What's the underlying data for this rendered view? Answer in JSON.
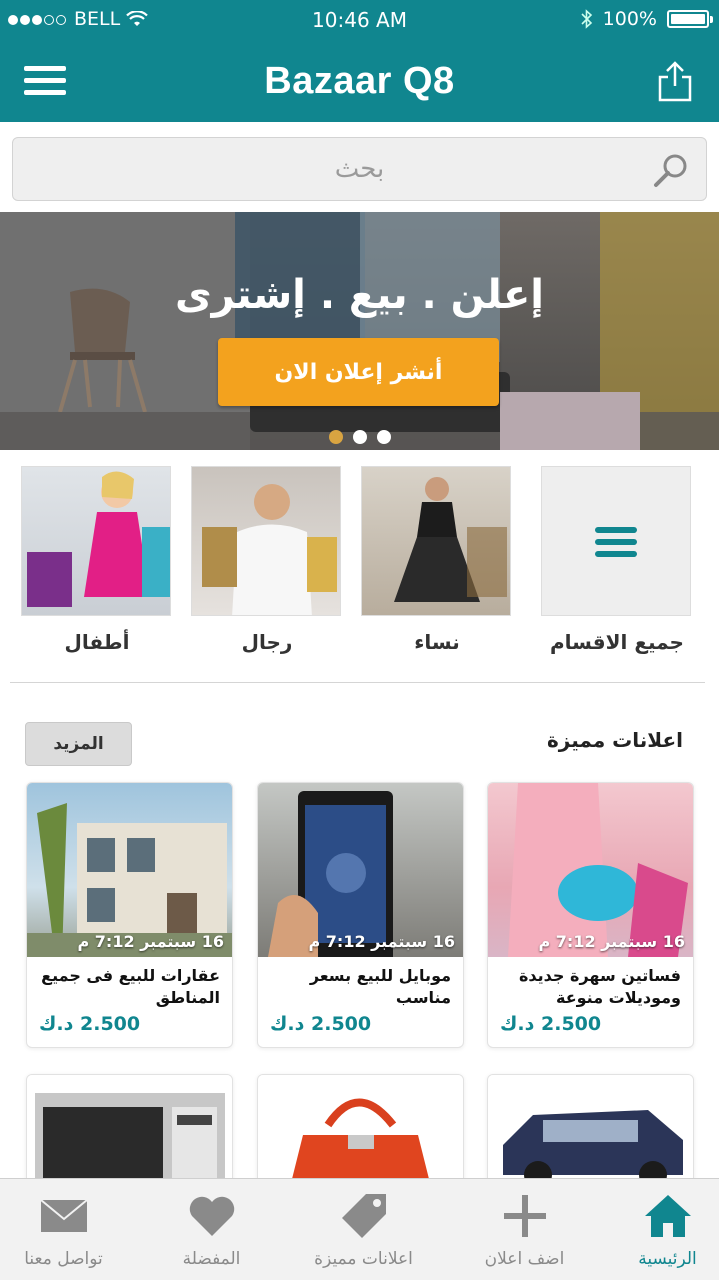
{
  "status_bar": {
    "carrier": "BELL",
    "time": "10:46 AM",
    "battery": "100%"
  },
  "nav": {
    "title": "Bazaar Q8"
  },
  "search": {
    "placeholder": "بحث"
  },
  "banner": {
    "headline": "إعلن . بيع . إشترى",
    "cta_label": "أنشر إعلان الان",
    "slide_count": 3,
    "active_slide": 1
  },
  "categories": [
    {
      "label": "جميع الاقسام"
    },
    {
      "label": "نساء"
    },
    {
      "label": "رجال"
    },
    {
      "label": "أطفال"
    }
  ],
  "featured": {
    "title": "اعلانات مميزة",
    "more_label": "المزيد",
    "items": [
      {
        "date": "16 سبتمبر 7:12 م",
        "title": "فساتين سهرة جديدة وموديلات منوعة",
        "price": "2.500 د.ك"
      },
      {
        "date": "16 سبتمبر 7:12 م",
        "title": "موبايل للبيع بسعر مناسب",
        "price": "2.500 د.ك"
      },
      {
        "date": "16 سبتمبر 7:12 م",
        "title": "عقارات للبيع فى جميع المناطق",
        "price": "2.500 د.ك"
      }
    ]
  },
  "tabs": [
    {
      "label": "الرئيسية",
      "icon": "home-icon",
      "active": true
    },
    {
      "label": "اضف اعلان",
      "icon": "plus-icon",
      "active": false
    },
    {
      "label": "اعلانات مميزة",
      "icon": "tag-icon",
      "active": false
    },
    {
      "label": "المفضلة",
      "icon": "heart-icon",
      "active": false
    },
    {
      "label": "تواصل معنا",
      "icon": "envelope-icon",
      "active": false
    }
  ],
  "colors": {
    "primary": "#10868f",
    "accent": "#f3a21e",
    "inactive": "#8a8a8a"
  }
}
